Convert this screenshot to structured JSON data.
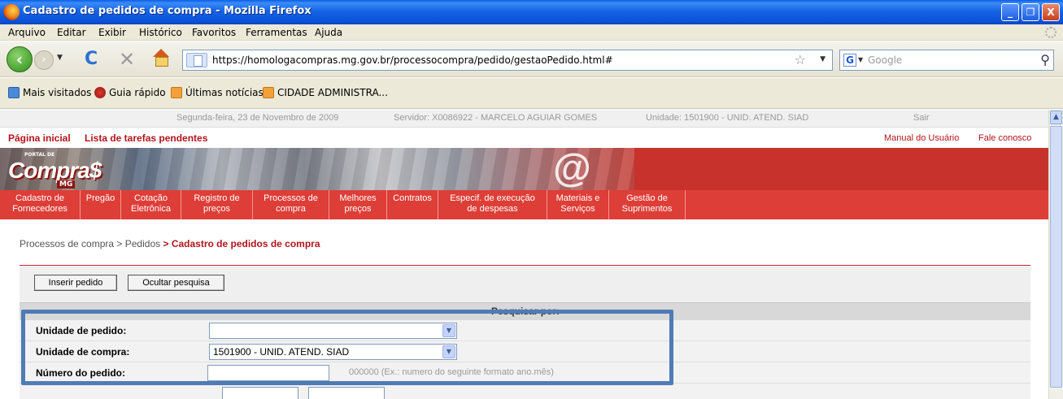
{
  "window": {
    "title": "Cadastro de pedidos de compra - Mozilla Firefox",
    "controls": {
      "minimize": "_",
      "maximize": "❐",
      "close": "X"
    }
  },
  "menu": [
    "Arquivo",
    "Editar",
    "Exibir",
    "Histórico",
    "Favoritos",
    "Ferramentas",
    "Ajuda"
  ],
  "nav": {
    "back": "‹",
    "forward": "›",
    "dropdown": "▼",
    "reload": "C",
    "stop": "✕",
    "url": "https://homologacompras.mg.gov.br/processocompra/pedido/gestaoPedido.html#",
    "bookmark_star": "☆",
    "url_dropdown": "▼",
    "search_engine": "G",
    "search_dropdown": "▼",
    "search_placeholder": "Google",
    "search_button": "⚲"
  },
  "bookmarks": [
    "Mais visitados",
    "Guia rápido",
    "Últimas notícias",
    "CIDADE ADMINISTRA..."
  ],
  "infobar": {
    "date": "Segunda-feira, 23 de Novembro de 2009",
    "server": "Servidor: X0086922 - MARCELO AGUIAR GOMES",
    "unit": "Unidade: 1501900 - UNID. ATEND. SIAD",
    "logout": "Sair"
  },
  "toplinks": {
    "home": "Página inicial",
    "tasks": "Lista de tarefas pendentes",
    "manual": "Manual do Usuário",
    "contact": "Fale conosco"
  },
  "banner": {
    "logo_top": "PORTAL DE",
    "logo": "Compra$",
    "logo_sub": "MG",
    "at": "@"
  },
  "mainnav": [
    {
      "l1": "Cadastro de",
      "l2": "Fornecedores"
    },
    {
      "l1": "Pregão",
      "l2": ""
    },
    {
      "l1": "Cotação",
      "l2": "Eletrônica"
    },
    {
      "l1": "Registro de",
      "l2": "preços"
    },
    {
      "l1": "Processos de",
      "l2": "compra"
    },
    {
      "l1": "Melhores",
      "l2": "preços"
    },
    {
      "l1": "Contratos",
      "l2": ""
    },
    {
      "l1": "Especif. de execução",
      "l2": "de despesas"
    },
    {
      "l1": "Materiais e",
      "l2": "Serviços"
    },
    {
      "l1": "Gestão de",
      "l2": "Suprimentos"
    }
  ],
  "breadcrumb": {
    "p1": "Processos de compra",
    "sep1": " > ",
    "p2": "Pedidos",
    "sep2": " > ",
    "current": "Cadastro de pedidos de compra"
  },
  "actions": {
    "insert": "Inserir pedido",
    "hide_search": "Ocultar pesquisa"
  },
  "search": {
    "header": "Pesquisar por:",
    "unidade_pedido": {
      "label": "Unidade de pedido:",
      "value": ""
    },
    "unidade_compra": {
      "label": "Unidade de compra:",
      "value": "1501900 - UNID. ATEND. SIAD"
    },
    "numero_pedido": {
      "label": "Número do pedido:",
      "hint": "000000 (Ex.: numero do seguinte formato ano.mês)"
    }
  },
  "colors": {
    "brand_red": "#c7322c",
    "nav_red": "#dd3e37",
    "link_red": "#b3141c",
    "highlight": "#4f7bb6"
  }
}
